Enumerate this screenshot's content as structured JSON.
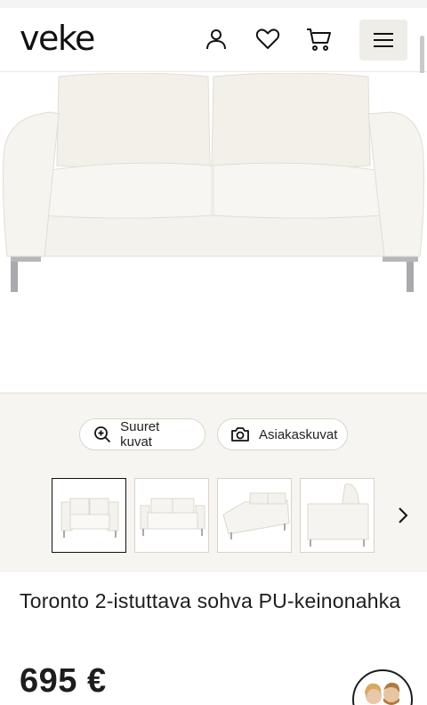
{
  "header": {
    "logo": "veke",
    "icons": [
      "user-icon",
      "heart-icon",
      "cart-icon",
      "hamburger-menu-icon"
    ]
  },
  "gallery": {
    "large_images_label": "Suuret kuvat",
    "customer_images_label": "Asiakaskuvat",
    "thumbnails_count": 4,
    "selected_thumbnail": 1
  },
  "product": {
    "title": "Toronto 2-istuttava sohva PU-keinonahka",
    "price": "695 €"
  },
  "colors": {
    "gallery_bg": "#f7f5f1",
    "menu_button_bg": "#efede7",
    "text": "#1d1d1d"
  }
}
